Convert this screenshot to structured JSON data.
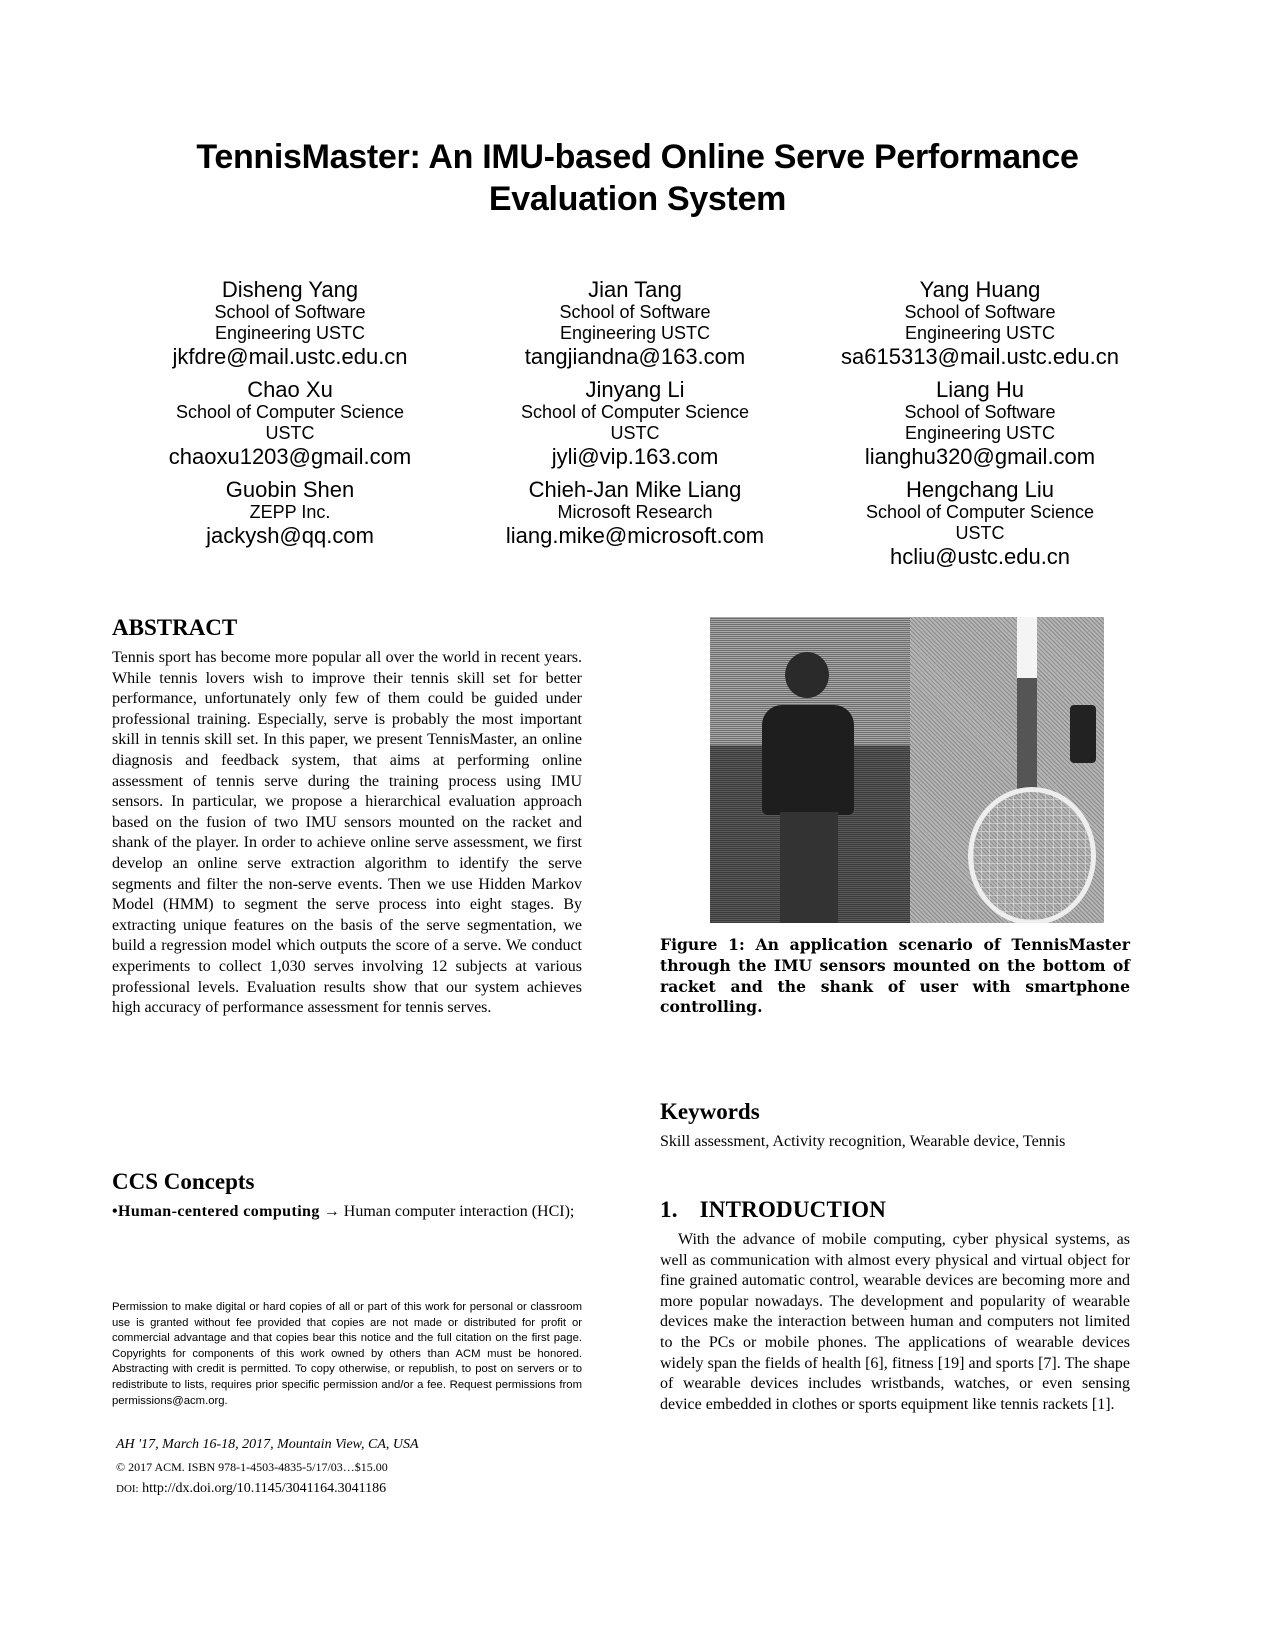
{
  "paper": {
    "title_line1": "TennisMaster: An IMU-based Online Serve Performance",
    "title_line2": "Evaluation System",
    "authors": [
      [
        {
          "name": "Disheng Yang",
          "affiliation": [
            "School of Software",
            "Engineering USTC"
          ],
          "email": "jkfdre@mail.ustc.edu.cn"
        },
        {
          "name": "Jian Tang",
          "affiliation": [
            "School of Software",
            "Engineering USTC"
          ],
          "email": "tangjiandna@163.com"
        },
        {
          "name": "Yang Huang",
          "affiliation": [
            "School of Software",
            "Engineering USTC"
          ],
          "email": "sa615313@mail.ustc.edu.cn"
        }
      ],
      [
        {
          "name": "Chao Xu",
          "affiliation": [
            "School of Computer Science",
            "USTC"
          ],
          "email": "chaoxu1203@gmail.com"
        },
        {
          "name": "Jinyang Li",
          "affiliation": [
            "School of Computer Science",
            "USTC"
          ],
          "email": "jyli@vip.163.com"
        },
        {
          "name": "Liang Hu",
          "affiliation": [
            "School of Software",
            "Engineering USTC"
          ],
          "email": "lianghu320@gmail.com"
        }
      ],
      [
        {
          "name": "Guobin Shen",
          "affiliation": [
            "ZEPP Inc."
          ],
          "email": "jackysh@qq.com"
        },
        {
          "name": "Chieh-Jan Mike Liang",
          "affiliation": [
            "Microsoft Research"
          ],
          "email": "liang.mike@microsoft.com"
        },
        {
          "name": "Hengchang Liu",
          "affiliation": [
            "School of Computer Science",
            "USTC"
          ],
          "email": "hcliu@ustc.edu.cn"
        }
      ]
    ],
    "abstract": {
      "heading": "ABSTRACT",
      "text": "Tennis sport has become more popular all over the world in recent years. While tennis lovers wish to improve their tennis skill set for better performance, unfortunately only few of them could be guided under professional training. Especially, serve is probably the most important skill in tennis skill set. In this paper, we present TennisMaster, an online diagnosis and feedback system, that aims at performing online assessment of tennis serve during the training process using IMU sensors. In particular, we propose a hierarchical evaluation approach based on the fusion of two IMU sensors mounted on the racket and shank of the player. In order to achieve online serve assessment, we first develop an online serve extraction algorithm to identify the serve segments and filter the non-serve events. Then we use Hidden Markov Model (HMM) to segment the serve process into eight stages. By extracting unique features on the basis of the serve segmentation, we build a regression model which outputs the score of a serve. We conduct experiments to collect 1,030 serves involving 12 subjects at various professional levels. Evaluation results show that our system achieves high accuracy of performance assessment for tennis serves."
    },
    "ccs": {
      "heading": "CCS Concepts",
      "bullet": "•",
      "bold_term": "Human-centered computing",
      "arrow": " → ",
      "rest": "Human computer interaction (HCI);"
    },
    "permission_notice": "Permission to make digital or hard copies of all or part of this work for personal or classroom use is granted without fee provided that copies are not made or distributed for profit or commercial advantage and that copies bear this notice and the full citation on the first page. Copyrights for components of this work owned by others than ACM must be honored. Abstracting with credit is permitted. To copy otherwise, or republish, to post on servers or to redistribute to lists, requires prior specific permission and/or a fee. Request permissions from permissions@acm.org.",
    "conference": {
      "venue": "AH '17, March 16-18, 2017, Mountain View, CA, USA",
      "copyright": "© 2017 ACM. ISBN 978-1-4503-4835-5/17/03…$15.00",
      "doi_label": "DOI:",
      "doi_url": " http://dx.doi.org/10.1145/3041164.3041186"
    },
    "figure": {
      "description": "Photo: a player standing on a tennis court holding a racket (left) and a tennis racket with IMU sensor and smartphone (right)",
      "caption": "Figure 1: An application scenario of TennisMaster through the IMU sensors mounted on the bottom of racket and the shank of user with smartphone controlling."
    },
    "keywords": {
      "heading": "Keywords",
      "text": "Skill assessment, Activity recognition, Wearable device, Tennis"
    },
    "introduction": {
      "number": "1.",
      "heading": "INTRODUCTION",
      "text": "With the advance of mobile computing, cyber physical systems, as well as communication with almost every physical and virtual object for fine grained automatic control, wearable devices are becoming more and more popular nowadays. The development and popularity of wearable devices make the interaction between human and computers not limited to the PCs or mobile phones. The applications of wearable devices widely span the fields of health [6], fitness [19] and sports [7]. The shape of wearable devices includes wristbands, watches, or even sensing device embedded in clothes or sports equipment like tennis rackets [1]."
    }
  }
}
